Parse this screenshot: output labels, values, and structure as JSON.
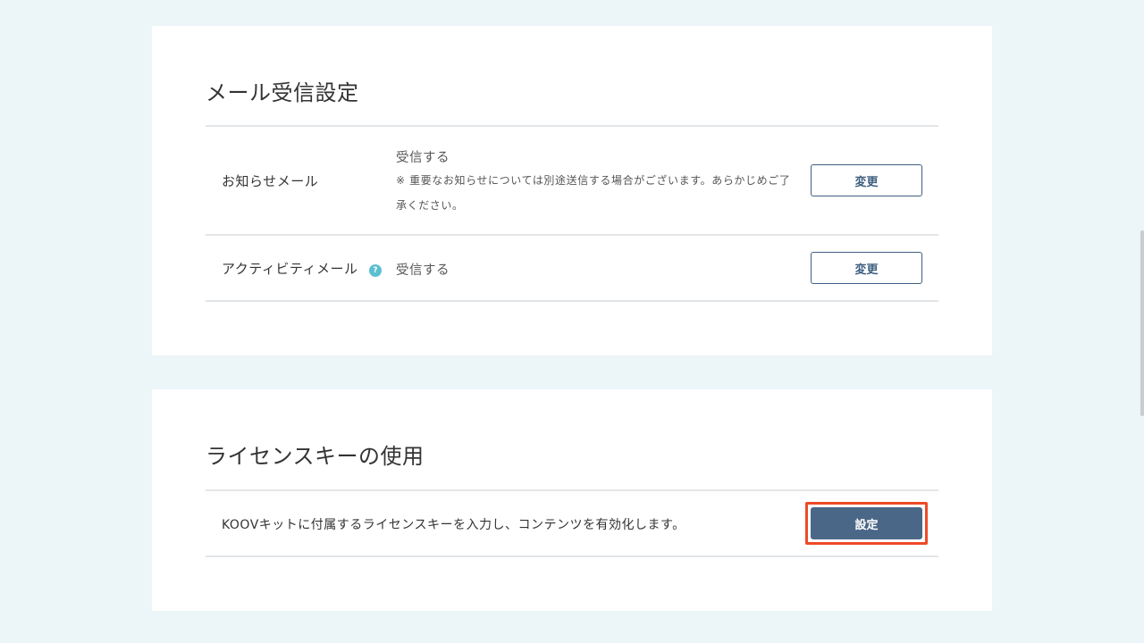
{
  "mail_settings": {
    "title": "メール受信設定",
    "rows": [
      {
        "label": "お知らせメール",
        "value": "受信する",
        "note": "※ 重要なお知らせについては別途送信する場合がございます。あらかじめご了承ください。",
        "button": "変更"
      },
      {
        "label": "アクティビティメール",
        "help_icon": "?",
        "value": "受信する",
        "button": "変更"
      }
    ]
  },
  "license": {
    "title": "ライセンスキーの使用",
    "description": "KOOVキットに付属するライセンスキーを入力し、コンテンツを有効化します。",
    "button": "設定"
  },
  "colors": {
    "background": "#ecf5f8",
    "button_border": "#3f5f80",
    "primary_button": "#4a6787",
    "highlight": "#ee4a26",
    "help_icon": "#5cbfcf"
  }
}
